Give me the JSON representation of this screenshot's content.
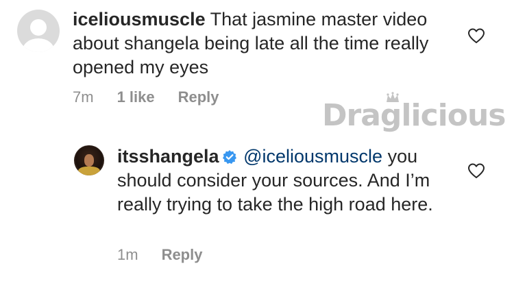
{
  "comments": [
    {
      "username": "iceliousmuscle",
      "text": "That jasmine master video about shangela being late all the time really opened my eyes",
      "time": "7m",
      "likes": "1 like",
      "reply_label": "Reply"
    },
    {
      "username": "itsshangela",
      "verified": true,
      "mention": "@iceliousmuscle",
      "text": "you should consider your sources. And I’m really trying to take the high road here.",
      "time": "1m",
      "reply_label": "Reply"
    }
  ],
  "watermark": {
    "text": "Draglicious"
  },
  "colors": {
    "text": "#262626",
    "meta": "#8e8e8e",
    "mention": "#00376b",
    "verified": "#3897f0",
    "watermark": "#c4c4c4"
  },
  "icons": {
    "like": "heart-outline-icon",
    "verified": "verified-badge-icon",
    "default_avatar": "default-avatar-icon",
    "crown": "crown-icon"
  }
}
